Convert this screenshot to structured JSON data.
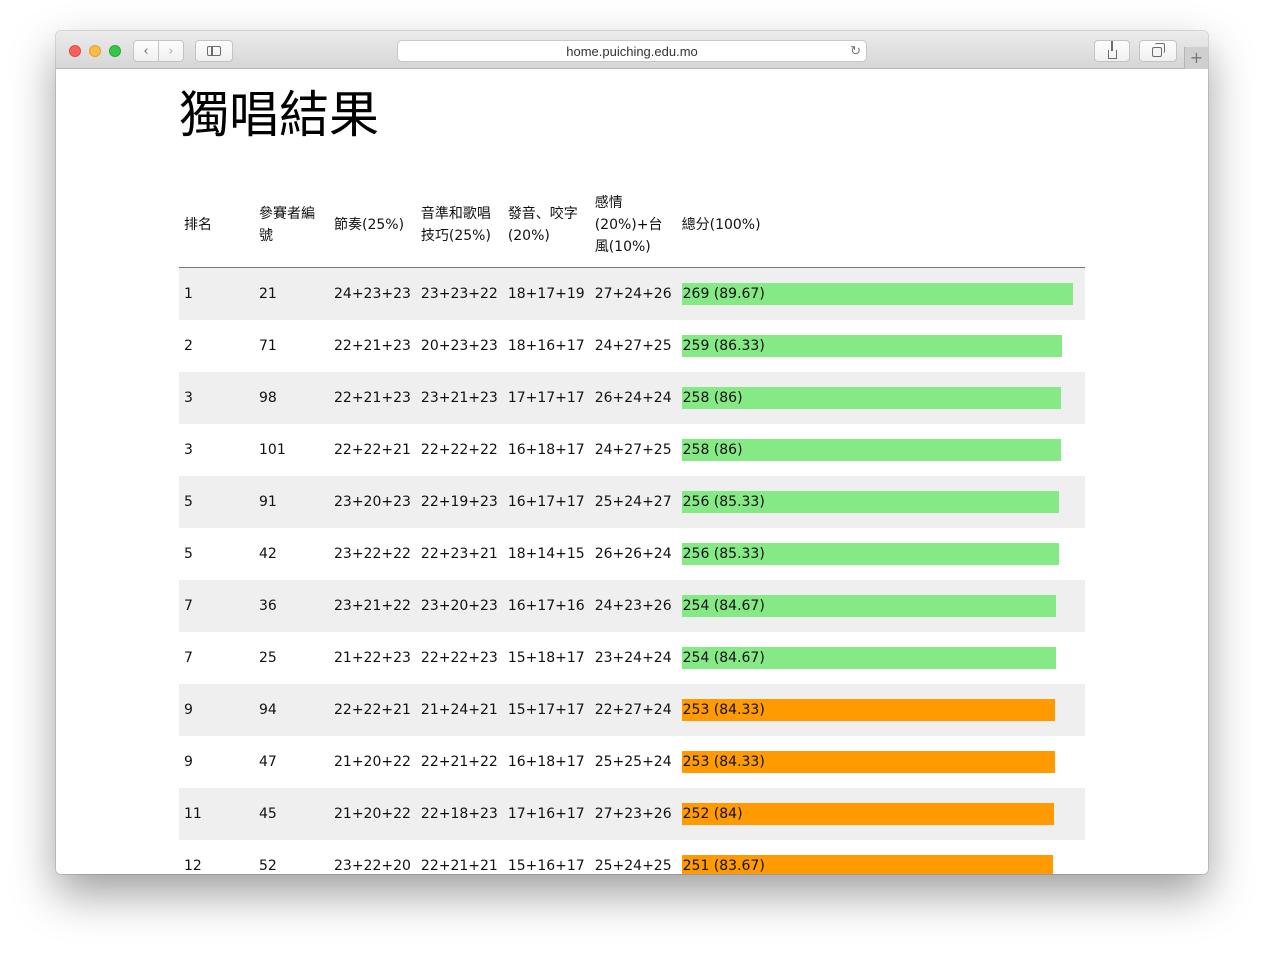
{
  "browser": {
    "url": "home.puiching.edu.mo",
    "back_icon": "‹",
    "forward_icon": "›",
    "reload_icon": "↻",
    "new_tab_icon": "+"
  },
  "page": {
    "title": "獨唱結果"
  },
  "colors": {
    "bar_high": "#85e985",
    "bar_mid": "#ff9b00"
  },
  "table": {
    "headers": {
      "rank": "排名",
      "contestant": "參賽者編號",
      "rhythm": "節奏(25%)",
      "pitch": "音準和歌唱技巧(25%)",
      "diction": "發音、咬字(20%)",
      "emotion": "感情(20%)+台風(10%)",
      "total": "總分(100%)"
    },
    "rows": [
      {
        "rank": "1",
        "contestant": "21",
        "rhythm": "24+23+23",
        "pitch": "23+23+22",
        "diction": "18+17+19",
        "emotion": "27+24+26",
        "total": "269 (89.67)",
        "score_pct": 89.67,
        "color": "#85e985"
      },
      {
        "rank": "2",
        "contestant": "71",
        "rhythm": "22+21+23",
        "pitch": "20+23+23",
        "diction": "18+16+17",
        "emotion": "24+27+25",
        "total": "259 (86.33)",
        "score_pct": 86.33,
        "color": "#85e985"
      },
      {
        "rank": "3",
        "contestant": "98",
        "rhythm": "22+21+23",
        "pitch": "23+21+23",
        "diction": "17+17+17",
        "emotion": "26+24+24",
        "total": "258 (86)",
        "score_pct": 86,
        "color": "#85e985"
      },
      {
        "rank": "3",
        "contestant": "101",
        "rhythm": "22+22+21",
        "pitch": "22+22+22",
        "diction": "16+18+17",
        "emotion": "24+27+25",
        "total": "258 (86)",
        "score_pct": 86,
        "color": "#85e985"
      },
      {
        "rank": "5",
        "contestant": "91",
        "rhythm": "23+20+23",
        "pitch": "22+19+23",
        "diction": "16+17+17",
        "emotion": "25+24+27",
        "total": "256 (85.33)",
        "score_pct": 85.33,
        "color": "#85e985"
      },
      {
        "rank": "5",
        "contestant": "42",
        "rhythm": "23+22+22",
        "pitch": "22+23+21",
        "diction": "18+14+15",
        "emotion": "26+26+24",
        "total": "256 (85.33)",
        "score_pct": 85.33,
        "color": "#85e985"
      },
      {
        "rank": "7",
        "contestant": "36",
        "rhythm": "23+21+22",
        "pitch": "23+20+23",
        "diction": "16+17+16",
        "emotion": "24+23+26",
        "total": "254 (84.67)",
        "score_pct": 84.67,
        "color": "#85e985"
      },
      {
        "rank": "7",
        "contestant": "25",
        "rhythm": "21+22+23",
        "pitch": "22+22+23",
        "diction": "15+18+17",
        "emotion": "23+24+24",
        "total": "254 (84.67)",
        "score_pct": 84.67,
        "color": "#85e985"
      },
      {
        "rank": "9",
        "contestant": "94",
        "rhythm": "22+22+21",
        "pitch": "21+24+21",
        "diction": "15+17+17",
        "emotion": "22+27+24",
        "total": "253 (84.33)",
        "score_pct": 84.33,
        "color": "#ff9b00"
      },
      {
        "rank": "9",
        "contestant": "47",
        "rhythm": "21+20+22",
        "pitch": "22+21+22",
        "diction": "16+18+17",
        "emotion": "25+25+24",
        "total": "253 (84.33)",
        "score_pct": 84.33,
        "color": "#ff9b00"
      },
      {
        "rank": "11",
        "contestant": "45",
        "rhythm": "21+20+22",
        "pitch": "22+18+23",
        "diction": "17+16+17",
        "emotion": "27+23+26",
        "total": "252 (84)",
        "score_pct": 84,
        "color": "#ff9b00"
      },
      {
        "rank": "12",
        "contestant": "52",
        "rhythm": "23+22+20",
        "pitch": "22+21+21",
        "diction": "15+16+17",
        "emotion": "25+24+25",
        "total": "251 (83.67)",
        "score_pct": 83.67,
        "color": "#ff9b00"
      }
    ]
  }
}
